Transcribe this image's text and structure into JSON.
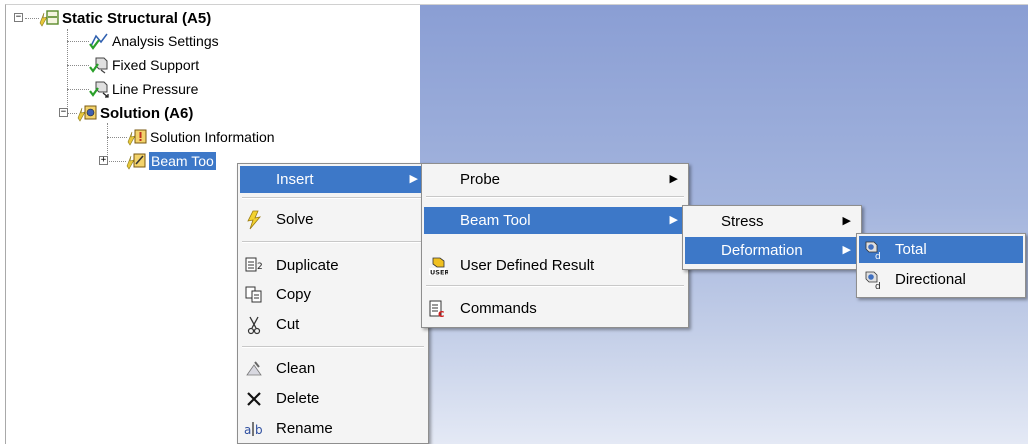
{
  "tree": {
    "static_structural": "Static Structural (A5)",
    "analysis_settings": "Analysis Settings",
    "fixed_support": "Fixed Support",
    "line_pressure": "Line Pressure",
    "solution": "Solution (A6)",
    "solution_information": "Solution Information",
    "beam_tool": "Beam Too"
  },
  "context_menu": {
    "insert": "Insert",
    "solve": "Solve",
    "duplicate": "Duplicate",
    "copy": "Copy",
    "cut": "Cut",
    "clean": "Clean",
    "delete": "Delete",
    "rename": "Rename"
  },
  "insert_submenu": {
    "probe": "Probe",
    "beam_tool": "Beam Tool",
    "user_defined_result": "User Defined Result",
    "commands": "Commands"
  },
  "beam_tool_submenu": {
    "stress": "Stress",
    "deformation": "Deformation"
  },
  "deformation_submenu": {
    "total": "Total",
    "directional": "Directional"
  },
  "colors": {
    "highlight": "#3d78c8",
    "menu_bg": "#f4f4f4",
    "viewport_top": "#8a9ed4",
    "viewport_bottom": "#e4e9f5"
  }
}
